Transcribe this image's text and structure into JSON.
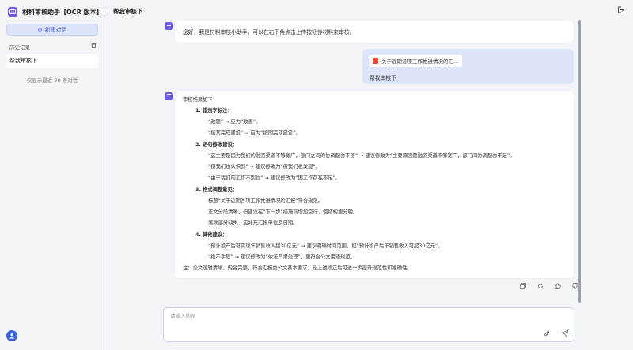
{
  "sidebar": {
    "title": "材料审核助手【OCR 版本】",
    "new_chat_label": "新建对话",
    "history_label": "历史记录",
    "history_items": [
      "帮我审核下"
    ],
    "history_note": "仅显示最近 20 条对话"
  },
  "header": {
    "title": "帮我审核下"
  },
  "messages": {
    "greeting": "您好，我是材料审核小助手，可以在右下角点击上传按钮传材料来审核。",
    "user_file": "关于近期各项工作推进情况的汇...",
    "user_text": "帮我审核下",
    "review": {
      "intro": "审核结果如下：",
      "s1_title": "1. 错别字标注：",
      "s1_l1": "“改题” → 应为“改善”。",
      "s1_l2": "“按其完成建设” → 应为“按期完成建设”。",
      "s2_title": "2. 语句修改建议：",
      "s2_l1": "“这主要是因为我们的融资渠道不够宽广，部门之间的协调配合不够” → 建议修改为“主要原因是融资渠道不够宽广，部门间协调配合不足”。",
      "s2_l2": "“但我们也认识到” → 建议修改为“但我们也发现”。",
      "s2_l3": "“由于我们的工作不到位” → 建议修改为“因工作存在不足”。",
      "s3_title": "3. 格式调整意见：",
      "s3_l1": "标题“关于近期各项工作推进情况的汇报”符合规范。",
      "s3_l2": "正文分段清晰，但建议在“下一步”措施前增加空行，使结构更分明。",
      "s3_l3": "落款部分缺失，应补充汇报单位及日期。",
      "s4_title": "4. 其他建议：",
      "s4_l1": "“预计投产后可实现年销售收入超30亿元” → 建议明确时间范围，如“预计投产后年销售收入可超30亿元”。",
      "s4_l2": "“绝不手软” → 建议修改为“依法严肃处理”，更符合公文用语规范。",
      "note": "注：全文逻辑清晰，内容完整，符合汇报类公文基本要求，经上述修正后可进一步提升规范性和准确性。"
    }
  },
  "input": {
    "placeholder": "请输入问题"
  },
  "icons": {
    "logo": "chat-bot-icon",
    "new_chat": "plus-circle-icon",
    "trash": "trash-icon",
    "collapse": "chevron-left-icon",
    "exit": "exit-icon",
    "pdf": "pdf-icon",
    "copy": "copy-icon",
    "refresh": "refresh-icon",
    "like": "thumbs-up-icon",
    "dislike": "thumbs-down-icon",
    "attach": "paperclip-icon",
    "send": "send-icon",
    "avatar": "user-avatar-icon"
  },
  "colors": {
    "accent": "#4a5bd0",
    "brand": "#6c5ce7",
    "user_bubble": "#dde5fb"
  }
}
